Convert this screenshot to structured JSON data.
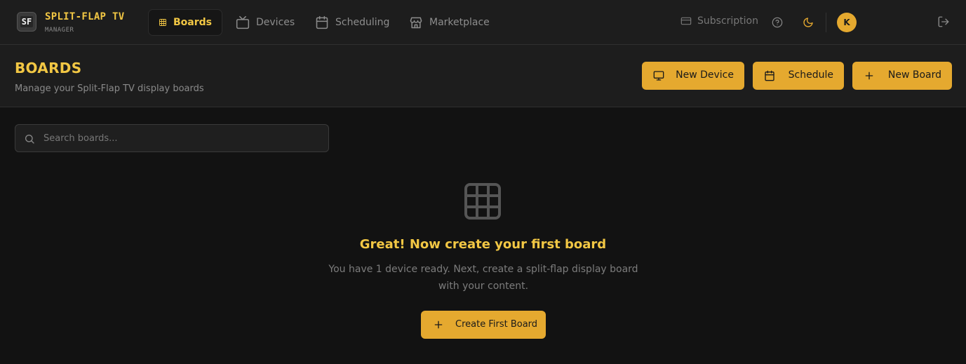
{
  "brand": {
    "logo_text": "SF",
    "title": "SPLIT-FLAP TV",
    "subtitle": "MANAGER"
  },
  "nav": {
    "items": [
      {
        "label": "Boards",
        "icon": "grid-icon",
        "active": true
      },
      {
        "label": "Devices",
        "icon": "tv-icon",
        "active": false
      },
      {
        "label": "Scheduling",
        "icon": "calendar-icon",
        "active": false
      },
      {
        "label": "Marketplace",
        "icon": "store-icon",
        "active": false
      }
    ],
    "subscription_label": "Subscription",
    "avatar_initial": "K"
  },
  "header": {
    "title": "BOARDS",
    "subtitle": "Manage your Split-Flap TV display boards",
    "buttons": {
      "new_device": "New Device",
      "schedule": "Schedule",
      "new_board": "New Board"
    }
  },
  "search": {
    "placeholder": "Search boards..."
  },
  "empty_state": {
    "title": "Great! Now create your first board",
    "text": "You have 1 device ready. Next, create a split-flap display board with your content.",
    "button_label": "Create First Board"
  },
  "colors": {
    "accent": "#f2c744",
    "button": "#e5a92f",
    "background": "#121212",
    "panel": "#1d1d1d"
  }
}
